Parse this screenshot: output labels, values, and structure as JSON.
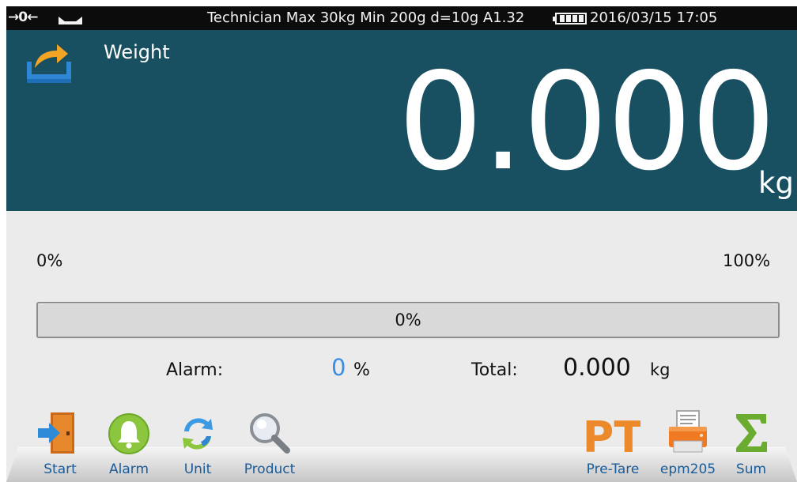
{
  "status": {
    "zero_indicator": "→0←",
    "info": "Technician Max 30kg  Min 200g  d=10g A1.32",
    "datetime": "2016/03/15  17:05"
  },
  "weight": {
    "label": "Weight",
    "value": "0.000",
    "unit": "kg"
  },
  "progress": {
    "min_label": "0%",
    "max_label": "100%",
    "value_text": "0%",
    "fraction": 0
  },
  "alarm": {
    "label": "Alarm:",
    "value": "0",
    "unit": "%"
  },
  "total": {
    "label": "Total:",
    "value": "0.000",
    "unit": "kg"
  },
  "toolbar": {
    "left": [
      {
        "label": "Start",
        "icon": "door-enter-icon"
      },
      {
        "label": "Alarm",
        "icon": "bell-icon"
      },
      {
        "label": "Unit",
        "icon": "refresh-cycle-icon"
      },
      {
        "label": "Product",
        "icon": "magnifier-icon"
      }
    ],
    "right": [
      {
        "label": "Pre-Tare",
        "icon": "pt-text-icon"
      },
      {
        "label": "epm205",
        "icon": "printer-icon"
      },
      {
        "label": "Sum",
        "icon": "sigma-icon"
      }
    ]
  },
  "colors": {
    "panel": "#185061",
    "accent_blue": "#3b8fe2",
    "label_blue": "#1b5b98",
    "status_bar": "#0c0c0c"
  }
}
